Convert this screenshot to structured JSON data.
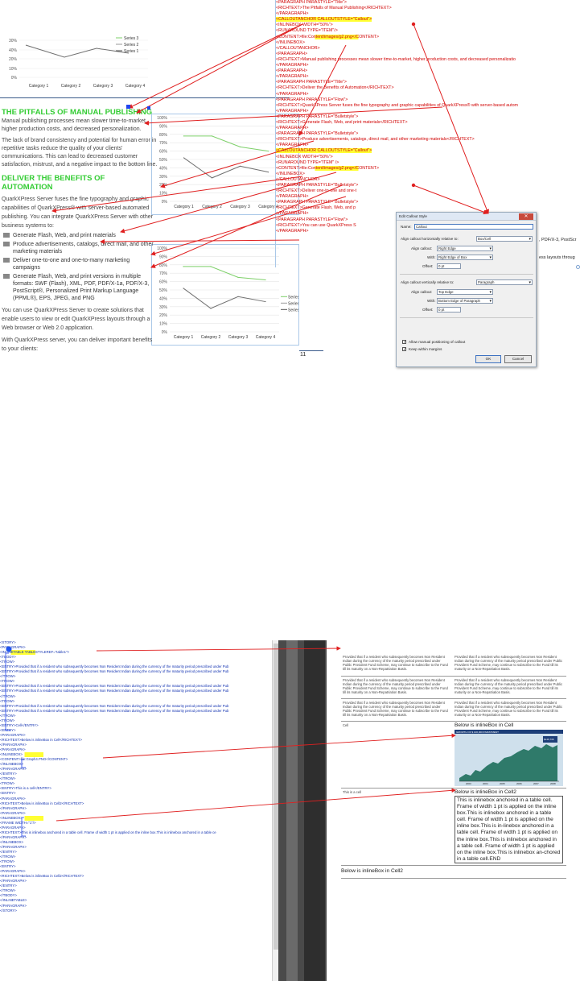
{
  "top_charts": {
    "y_ticks_small": [
      "30%",
      "40%",
      "20%",
      "10%",
      "0%"
    ],
    "y_ticks": [
      "100%",
      "90%",
      "80%",
      "70%",
      "60%",
      "50%",
      "40%",
      "30%",
      "20%",
      "10%",
      "0%"
    ],
    "categories": [
      "Category 1",
      "Category 2",
      "Category 3",
      "Category 4"
    ],
    "legend": [
      "Series 3",
      "Series 2",
      "Series 1"
    ]
  },
  "chart_data": [
    {
      "type": "line",
      "categories": [
        "Category 1",
        "Category 2",
        "Category 3",
        "Category 4"
      ],
      "series": [
        {
          "name": "Series 3",
          "values": [
            0.78,
            0.78,
            0.65,
            0.6
          ]
        },
        {
          "name": "Series 1",
          "values": [
            0.52,
            0.28,
            0.42,
            0.35
          ]
        }
      ],
      "ylim": [
        0,
        1
      ]
    },
    {
      "type": "line",
      "categories": [
        "Category 1",
        "Category 2",
        "Category 3",
        "Category 4"
      ],
      "series": [
        {
          "name": "Series 3",
          "values": [
            0.78,
            0.78,
            0.65,
            0.62
          ]
        },
        {
          "name": "Series 1",
          "values": [
            0.52,
            0.28,
            0.42,
            0.36
          ]
        }
      ],
      "ylim": [
        0,
        1
      ]
    }
  ],
  "doc": {
    "h1": "THE PITFALLS OF MANUAL PUBLISHING",
    "p1": "Manual publishing processes mean slower time-to-market, higher production costs, and decreased personalization.",
    "p2": "The lack of brand consistency and potential for human error in repetitive tasks reduce the quality of your clients' communications. This can lead to decreased customer satisfaction, mistrust, and a negative impact to the bottom line.",
    "h2": "DELIVER THE BENEFITS OF AUTOMATION",
    "p3": "QuarkXPress Server fuses the fine typography and graphic capabilities of QuarkXPress® with server-based automated publishing. You can integrate QuarkXPress Server with other business systems to:",
    "b1": "Generate Flash, Web, and print materials",
    "b2": "Produce advertisements, catalogs, direct mail, and other marketing materials",
    "b3": "Deliver one-to-one and one-to-many marketing campaigns",
    "b4": "Generate Flash, Web, and print versions in multiple formats: SWF (Flash), XML, PDF, PDF/X-1a, PDF/X-3, PostScript®, Personalized Print Markup Language (PPML®), EPS, JPEG, and PNG",
    "p4": "You can use QuarkXPress Server to create solutions that enable users to view or edit QuarkXPress layouts through a Web browser or Web 2.0 application.",
    "p5": "With QuarkXPress server, you can deliver important benefits to your clients:",
    "page_num": "11"
  },
  "xml1": [
    [
      "<PARAGRAPH PARASTYLE=\"Title\">",
      "r",
      ""
    ],
    [
      "  <RICHTEXT>The Pitfalls of Manual Publishing</RICHTEXT>",
      "r",
      ""
    ],
    [
      "</PARAGRAPH>",
      "r",
      ""
    ],
    [
      "<CALLOUTANCHOR CALLOUTSTYLE=\"Callout\">",
      "r",
      "hl"
    ],
    [
      "  <INLINEBOX WIDTH=\"50%\">",
      "r",
      ""
    ],
    [
      "   <RUNAROUND TYPE=\"ITEM\"/>",
      "r",
      ""
    ],
    [
      "     <CONTENT>file:Content/images/g2.png</CONTENT>",
      "r",
      "hlc"
    ],
    [
      "  </INLINEBOX>",
      "r",
      ""
    ],
    [
      "</CALLOUTANCHOR>",
      "r",
      ""
    ],
    [
      "<PARAGRAPH>",
      "r",
      ""
    ],
    [
      "  <RICHTEXT>Manual publishing processes mean slower time-to-market, higher production costs, and decreased personalizatio",
      "r",
      ""
    ],
    [
      "</PARAGRAPH>",
      "r",
      ""
    ],
    [
      "<PARAGRAPH>",
      "r",
      ""
    ],
    [
      "</PARAGRAPH>",
      "r",
      ""
    ],
    [
      "<PARAGRAPH PARASTYLE=\"Title\">",
      "r",
      ""
    ],
    [
      "  <RICHTEXT>Deliver the Benefits of Automation</RICHTEXT>",
      "r",
      ""
    ],
    [
      "</PARAGRAPH>",
      "r",
      ""
    ],
    [
      "<PARAGRAPH PARASTYLE=\"Flow\">",
      "r",
      ""
    ],
    [
      "  <RICHTEXT>QuarkXPress Server fuses the fine typography and graphic capabilities of QuarkXPress® with server-based autom",
      "r",
      ""
    ],
    [
      "</PARAGRAPH>",
      "r",
      ""
    ],
    [
      "<PARAGRAPH PARASTYLE=\"Bulletstyle\">",
      "r",
      ""
    ],
    [
      "  <RICHTEXT>Generate Flash, Web, and print materials</RICHTEXT>",
      "r",
      ""
    ],
    [
      "</PARAGRAPH>",
      "r",
      ""
    ],
    [
      "<PARAGRAPH PARASTYLE=\"Bulletstyle\">",
      "r",
      ""
    ],
    [
      "  <RICHTEXT>Produce advertisements, catalogs, direct mail, and other marketing materials</RICHTEXT>",
      "r",
      ""
    ],
    [
      "</PARAGRAPH>",
      "r",
      ""
    ],
    [
      "<CALLOUTANCHOR CALLOUTSTYLE=\"Callout\">",
      "r",
      "hl"
    ],
    [
      "  <INLINEBOX WIDTH=\"50%\">",
      "r",
      ""
    ],
    [
      "   <RUNAROUND TYPE=\"ITEM\" />",
      "r",
      ""
    ],
    [
      "     <CONTENT>file:Content/images/g2.png</CONTENT>",
      "r",
      "hlc"
    ],
    [
      "  </INLINEBOX>",
      "r",
      ""
    ],
    [
      "</CALLOUTANCHOR>",
      "r",
      ""
    ],
    [
      "<PARAGRAPH PARASTYLE=\"Bulletstyle\">",
      "r",
      ""
    ],
    [
      "  <RICHTEXT>Deliver one-to-one and one-t",
      "r",
      ""
    ],
    [
      "</PARAGRAPH>",
      "r",
      ""
    ],
    [
      "<PARAGRAPH PARASTYLE=\"Bulletstyle\">",
      "r",
      ""
    ],
    [
      "  <RICHTEXT>Generate Flash, Web, and p",
      "r",
      ""
    ],
    [
      "</PARAGRAPH>",
      "r",
      ""
    ],
    [
      "<PARAGRAPH PARASTYLE=\"Flow\">",
      "r",
      ""
    ],
    [
      "  <RICHTEXT>You can use QuarkXPress S",
      "r",
      ""
    ],
    [
      "</PARAGRAPH>",
      "r",
      ""
    ]
  ],
  "xml1_tail": [
    ", PDF/X-3, PostScr",
    "ess layouts throug"
  ],
  "dialog": {
    "title": "Edit Callout Style",
    "name_label": "Name:",
    "name_value": "Callout",
    "h_rel_label": "Align callout horizontally relative to:",
    "h_rel_value": "Box/Cell",
    "h_align_label": "Align callout:",
    "h_align_value": "Right Edge",
    "h_with_label": "With:",
    "h_with_value": "Right Edge of Box",
    "h_offset_label": "Offset:",
    "h_offset_value": "0 pt",
    "v_rel_label": "Align callout vertically relative to:",
    "v_rel_value": "Paragraph",
    "v_align_label": "Align callout:",
    "v_align_value": "Top Edge",
    "v_with_label": "With:",
    "v_with_value": "Bottom Edge of Paragraph",
    "v_offset_label": "Offset:",
    "v_offset_value": "0 pt",
    "chk1": "Allow manual positioning of callout",
    "chk2": "Keep within margins",
    "ok": "OK",
    "cancel": "Cancel"
  },
  "xml2": [
    "<STORY>",
    "  <PARAGRAPH>",
    "    <INLINETABLE TABLESTYLEREF=\"table1\">",
    "      <TBODY>",
    "        <TROW>",
    "          <ENTRY>Provided that if a resident who subsequently becomes Non Resident Indian during the currency of the maturity period prescribed under Pub",
    "          <ENTRY>Provided that if a resident who subsequently becomes Non Resident Indian during the currency of the maturity period prescribed under Pub",
    "        </TROW>",
    "        <TROW>",
    "          <ENTRY>Provided that if a resident who subsequently becomes Non Resident Indian during the currency of the maturity period prescribed under Pub",
    "          <ENTRY>Provided that if a resident who subsequently becomes Non Resident Indian during the currency of the maturity period prescribed under Pub",
    "        </TROW>",
    "        <TROW>",
    "          <ENTRY>Provided that if a resident who subsequently becomes Non Resident Indian during the currency of the maturity period prescribed under Pub",
    "          <ENTRY>Provided that if a resident who subsequently becomes Non Resident Indian during the currency of the maturity period prescribed under Pub",
    "        </TROW>",
    "        <TROW>",
    "          <ENTRY>Cell</ENTRY>",
    "          <ENTRY>",
    "            <PARAGRAPH>",
    "              <RICHTEXT>Below is inlineBox in Cell</RICHTEXT>",
    "            </PARAGRAPH>",
    "            <PARAGRAPH>",
    "              <INLINEBOX>",
    "                <CONTENT>file:Graph4.PNG</CONTENT>",
    "              </INLINEBOX>",
    "            </PARAGRAPH>",
    "          </ENTRY>",
    "        </TROW>",
    "        <TROW>",
    "          <ENTRY>This is a cell</ENTRY>",
    "          <ENTRY>",
    "            <PARAGRAPH>",
    "              <RICHTEXT>Below is inlineBox in Cell2</RICHTEXT>",
    "            </PARAGRAPH>",
    "            <PARAGRAPH>",
    "              <INLINEBOX>",
    "                <FRAME WIDTH=\"1\"/>",
    "                <PARAGRAPH>",
    "                  <RICHTEXT>This is inlinebox anchored in a table cell. Frame of width 1 pt is applied on the inline box.This is inlinebox anchored in a table ce",
    "                </PARAGRAPH>",
    "              </INLINEBOX>",
    "            </PARAGRAPH>",
    "          </ENTRY>",
    "        </TROW>",
    "        <TROW>",
    "          <ENTRY>",
    "            <PARAGRAPH>",
    "              <RICHTEXT>Below is inlineBox in Cell2</RICHTEXT>",
    "            </PARAGRAPH>",
    "          </ENTRY>",
    "        </TROW>",
    "      </TBODY>",
    "    </INLINETABLE>",
    "  </PARAGRAPH>",
    "</STORY>"
  ],
  "table2": {
    "para": "Provided that if a resident who subsequently becomes Non Resident Indian during the currency of the maturity period prescribed under Public Provident Fund Scheme, may continue to subscribe to the Fund till its maturity on a Non-Repatriation Basis.",
    "cell": "Cell",
    "below1": "Below is inlineBox in Cell",
    "graph_title": "GROWTH OF $ 100,000 INVESTMENT",
    "graph_legend": "$146,736",
    "graph_years": [
      "2003",
      "2004",
      "2005",
      "2006",
      "2007",
      "2008"
    ],
    "this_cell": "This is a cell",
    "below2": "Below is inlineBox in Cell2",
    "boxtext": "This is inlinebox anchored in a table cell. Frame of width 1 pt is applied on the inline box.This is inlinebox anchored in a table cell. Frame of width 1 pt is applied on the inline box.This is in-linebox anchored in a table cell. Frame of width 1 pt is applied on the inline box.This is inlinebox anchored in a table cell. Frame of width 1 pt is applied on the inline box.This is inlinebox an-chored in a table cell.END",
    "below3": "Below is inlineBox in Cell2"
  },
  "colors": {
    "green_heading": "#33cc33",
    "annotation": "#e02020",
    "highlight": "#ffff33",
    "xml_tag": "#d00000",
    "xml_text": "#1030b0"
  }
}
